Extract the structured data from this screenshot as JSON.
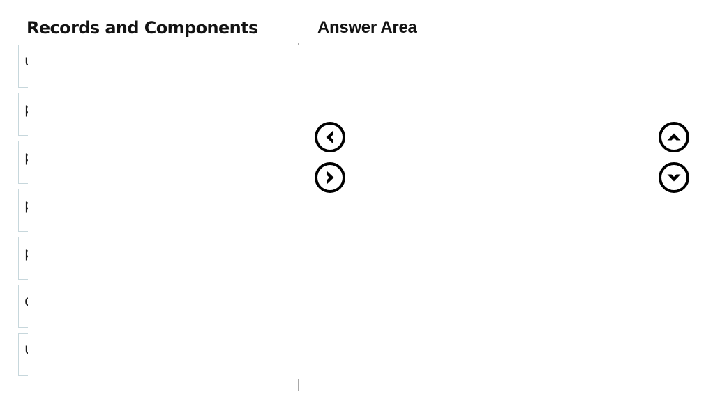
{
  "source_panel": {
    "heading": "Records and Components",
    "items": [
      {
        "label": "units"
      },
      {
        "label": "products"
      },
      {
        "label": "price lists"
      },
      {
        "label": "product families"
      },
      {
        "label": "price list items"
      },
      {
        "label": "discount lists"
      },
      {
        "label": "unit groups"
      }
    ]
  },
  "answer_panel": {
    "heading": "Answer Area",
    "placed_items": []
  },
  "controls": {
    "move_left": {
      "icon": "chevron-left-circle-icon",
      "label": ""
    },
    "move_right": {
      "icon": "chevron-right-circle-icon",
      "label": ""
    },
    "move_up": {
      "icon": "chevron-up-circle-icon",
      "label": ""
    },
    "move_down": {
      "icon": "chevron-down-circle-icon",
      "label": ""
    }
  },
  "colors": {
    "item_border": "#c7d7dc",
    "divider": "#a8a8a8",
    "text": "#1c1c1c",
    "background": "#ffffff",
    "icon": "#000000"
  }
}
